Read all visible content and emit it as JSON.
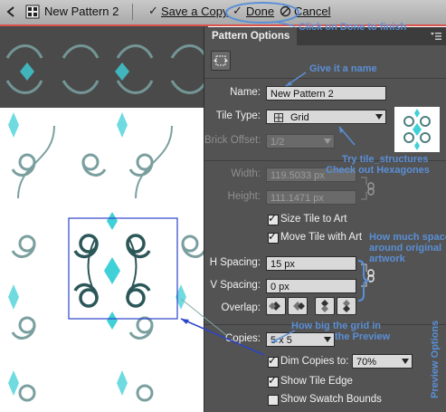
{
  "toolbar": {
    "pattern_name": "New Pattern 2",
    "save_copy": "Save a Copy",
    "done": "Done",
    "cancel": "Cancel"
  },
  "panel": {
    "tab": "Pattern Options",
    "name_label": "Name:",
    "name_value": "New Pattern 2",
    "tile_type_label": "Tile Type:",
    "tile_type_value": "Grid",
    "brick_offset_label": "Brick Offset:",
    "brick_offset_value": "1/2",
    "width_label": "Width:",
    "width_value": "119.5033 px",
    "height_label": "Height:",
    "height_value": "111.1471 px",
    "size_tile_to_art": "Size Tile to Art",
    "move_tile_with_art": "Move Tile with Art",
    "h_spacing_label": "H Spacing:",
    "h_spacing_value": "15 px",
    "v_spacing_label": "V Spacing:",
    "v_spacing_value": "0 px",
    "overlap_label": "Overlap:",
    "copies_label": "Copies:",
    "copies_value": "5 x 5",
    "dim_copies_label": "Dim Copies to:",
    "dim_copies_value": "70%",
    "show_tile_edge": "Show Tile Edge",
    "show_swatch_bounds": "Show Swatch Bounds",
    "checkboxes": {
      "size_tile_to_art": true,
      "move_tile_with_art": true,
      "dim_copies": true,
      "show_tile_edge": true,
      "show_swatch_bounds": false
    }
  },
  "annotations": {
    "done_hint": "Click on Done to finish",
    "name_hint": "Give it a name",
    "tile_hint_1": "Try tile_structures",
    "tile_hint_2": "Check out Hexagones",
    "spacing_hint_1": "How much space",
    "spacing_hint_2": "around original",
    "spacing_hint_3": "artwork",
    "grid_hint_1": "How big the grid in",
    "grid_hint_2": "the Preview",
    "preview_options": "Preview Options"
  },
  "colors": {
    "annotation": "#5a8fd6",
    "accent_cyan": "#3fd0d8",
    "swirl": "#4f7f80",
    "panel_bg": "#535353"
  },
  "icons": {
    "back": "back-arrow-icon",
    "pattern": "pattern-tile-icon",
    "check": "checkmark-icon",
    "cancel": "cancel-circle-icon",
    "tile_tool": "pattern-tile-tool-icon",
    "grid": "grid-icon",
    "link": "chain-link-icon",
    "overlap_left": "overlap-left-icon",
    "overlap_right": "overlap-right-icon",
    "overlap_top": "overlap-top-icon",
    "overlap_bottom": "overlap-bottom-icon",
    "panel_menu": "panel-menu-icon"
  }
}
